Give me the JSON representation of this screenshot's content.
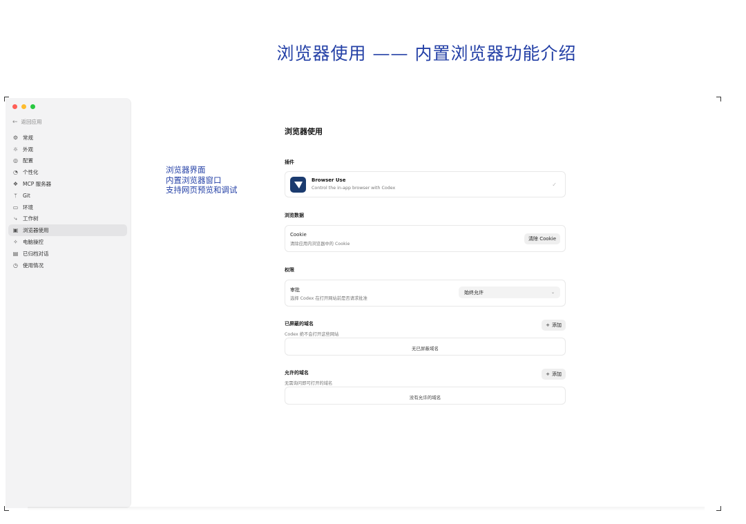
{
  "heading": "浏览器使用 —— 内置浏览器功能介绍",
  "annotation": [
    "浏览器界面",
    "内置浏览器窗口",
    "支持网页预览和调试"
  ],
  "sidebar": {
    "back_label": "返回应用",
    "items": [
      {
        "label": "常规",
        "icon": "gear-icon",
        "glyph": "⚙"
      },
      {
        "label": "外观",
        "icon": "sun-icon",
        "glyph": "☼"
      },
      {
        "label": "配置",
        "icon": "config-icon",
        "glyph": "◎"
      },
      {
        "label": "个性化",
        "icon": "personalize-icon",
        "glyph": "◔"
      },
      {
        "label": "MCP 服务器",
        "icon": "mcp-icon",
        "glyph": "❖"
      },
      {
        "label": "Git",
        "icon": "git-icon",
        "glyph": "ᛘ"
      },
      {
        "label": "环境",
        "icon": "environment-icon",
        "glyph": "▭"
      },
      {
        "label": "工作树",
        "icon": "worktree-icon",
        "glyph": "⤷"
      },
      {
        "label": "浏览器使用",
        "icon": "browser-icon",
        "glyph": "▣",
        "active": true
      },
      {
        "label": "电脑操控",
        "icon": "computer-control-icon",
        "glyph": "✧"
      },
      {
        "label": "已归档对话",
        "icon": "archive-icon",
        "glyph": "▤"
      },
      {
        "label": "使用情况",
        "icon": "usage-icon",
        "glyph": "◷"
      }
    ]
  },
  "main": {
    "title": "浏览器使用",
    "plugins": {
      "label": "插件",
      "name": "Browser Use",
      "description": "Control the in-app browser with Codex"
    },
    "browsing_data": {
      "label": "浏览数据",
      "row_title": "Cookie",
      "row_sub": "清除应用内浏览器中的 Cookie",
      "button": "清除 Cookie"
    },
    "permissions": {
      "label": "权限",
      "row_title": "审批",
      "row_sub": "选择 Codex 在打开网站前是否请求批准",
      "select_value": "始终允许"
    },
    "blocked": {
      "label": "已屏蔽的域名",
      "sub": "Codex 绝不会打开这些网站",
      "add": "添加",
      "empty": "无已屏蔽域名"
    },
    "allowed": {
      "label": "允许的域名",
      "sub": "无需询问即可打开的域名",
      "add": "添加",
      "empty": "没有允许的域名"
    }
  },
  "colors": {
    "accent_annotation": "#2440a6",
    "plugin_icon_bg": "#1b3b6f"
  }
}
